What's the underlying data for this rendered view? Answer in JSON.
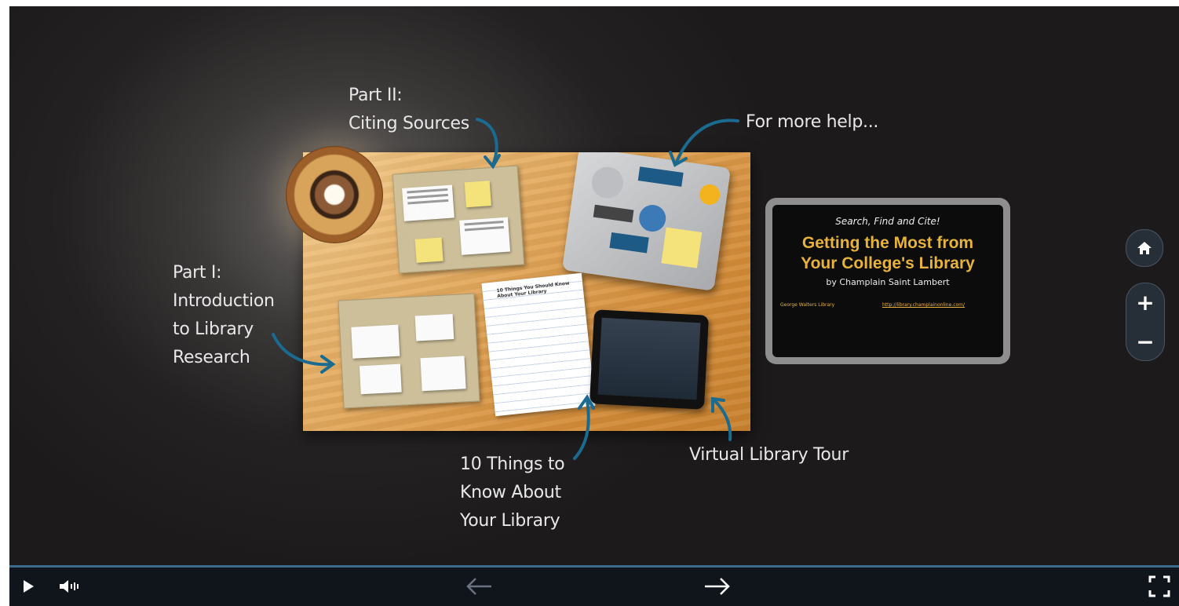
{
  "labels": {
    "part2": [
      "Part II:",
      "Citing Sources"
    ],
    "more_help": "For more help...",
    "part1": [
      "Part I:",
      "Introduction",
      "to Library",
      "Research"
    ],
    "ten_things": [
      "10 Things to",
      "Know About",
      "Your Library"
    ],
    "virtual_tour": "Virtual Library Tour"
  },
  "title_card": {
    "tagline": "Search, Find and Cite!",
    "title_line1": "Getting the Most from",
    "title_line2": "Your College's Library",
    "author": "by Champlain Saint Lambert",
    "footer_left": "George Walters Library",
    "footer_link": "http://library.champlainonline.com/"
  },
  "notebook_title": "10 Things You Should Know About Your Library",
  "controls": {
    "play_icon": "play-icon",
    "volume_icon": "volume-icon",
    "prev_icon": "arrow-left-icon",
    "next_icon": "arrow-right-icon",
    "fullscreen_icon": "fullscreen-icon"
  },
  "zoom": {
    "home_icon": "home-icon",
    "zoom_in": "+",
    "zoom_out": "−"
  },
  "colors": {
    "accent_arrow": "#1b6a90",
    "title_gold": "#e7b33a",
    "controls_bg": "#10151c"
  }
}
